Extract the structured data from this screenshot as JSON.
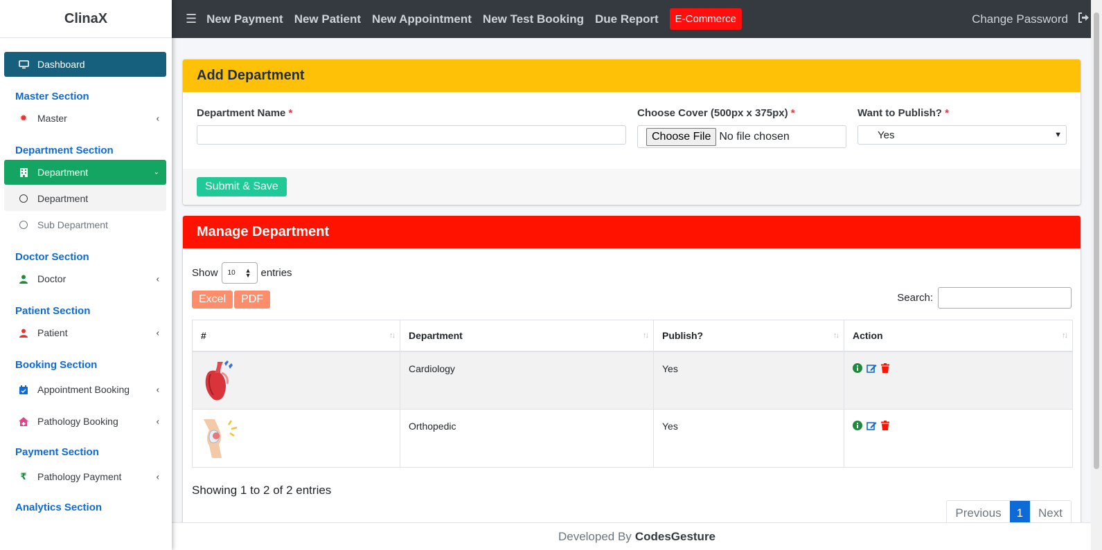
{
  "app": {
    "brand": "ClinaX"
  },
  "sidebar": {
    "dashboard": "Dashboard",
    "sections": {
      "master": "Master Section",
      "department": "Department Section",
      "doctor": "Doctor Section",
      "patient": "Patient Section",
      "booking": "Booking Section",
      "payment": "Payment Section",
      "analytics": "Analytics Section"
    },
    "items": {
      "master": "Master",
      "department": "Department",
      "department_sub": "Department",
      "sub_department": "Sub Department",
      "doctor": "Doctor",
      "patient": "Patient",
      "appointment_booking": "Appointment Booking",
      "pathology_booking": "Pathology Booking",
      "pathology_payment": "Pathology Payment"
    }
  },
  "topbar": {
    "links": [
      "New Payment",
      "New Patient",
      "New Appointment",
      "New Test Booking",
      "Due Report"
    ],
    "ecommerce": "E-Commerce",
    "change_password": "Change Password"
  },
  "add_department": {
    "title": "Add Department",
    "name_label": "Department Name",
    "cover_label": "Choose Cover (500px x 375px)",
    "publish_label": "Want to Publish?",
    "required_mark": "*",
    "file_button": "Choose File",
    "file_status": "No file chosen",
    "publish_value": "Yes",
    "submit": "Submit & Save"
  },
  "manage_department": {
    "title": "Manage Department",
    "show_label": "Show",
    "entries_label": "entries",
    "page_length": "10",
    "excel": "Excel",
    "pdf": "PDF",
    "search_label": "Search:",
    "columns": [
      "#",
      "Department",
      "Publish?",
      "Action"
    ],
    "rows": [
      {
        "image": "heart-image",
        "department": "Cardiology",
        "publish": "Yes"
      },
      {
        "image": "knee-image",
        "department": "Orthopedic",
        "publish": "Yes"
      }
    ],
    "info": "Showing 1 to 2 of 2 entries",
    "pagination": {
      "previous": "Previous",
      "current": "1",
      "next": "Next"
    }
  },
  "footer": {
    "text": "Developed By",
    "brand": "CodesGesture"
  },
  "colors": {
    "topbar": "#343a40",
    "dashboard_item": "#17607d",
    "active_item": "#14a562",
    "section_head": "#0d6ad6",
    "add_header": "#ffc107",
    "manage_header": "#ff1300",
    "save_button": "#20c997",
    "export_button": "#fd8d6b"
  }
}
